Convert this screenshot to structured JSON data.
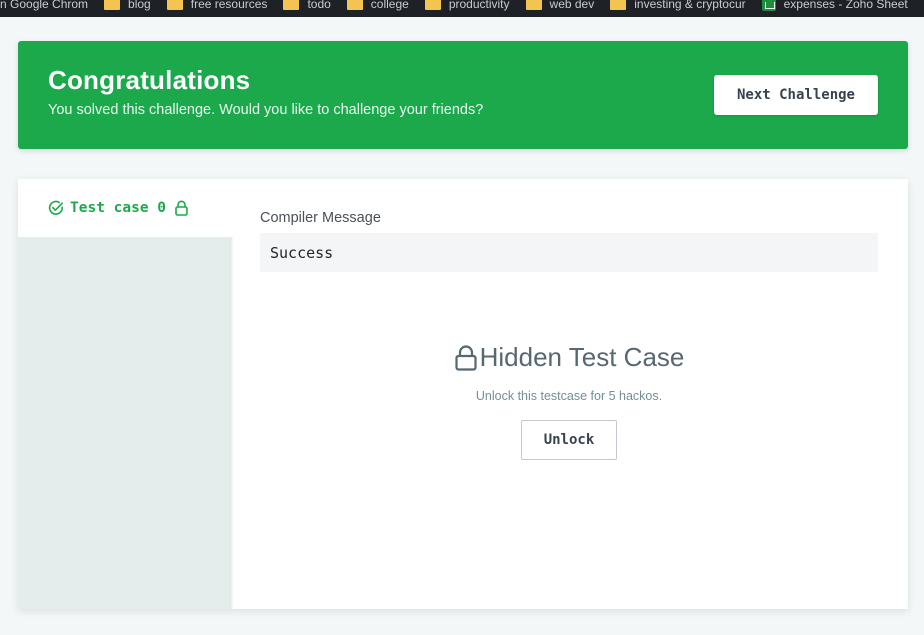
{
  "bookmarks": [
    {
      "label": "n Google Chrom",
      "icon": "none"
    },
    {
      "label": "blog",
      "icon": "folder-icon"
    },
    {
      "label": "free resources",
      "icon": "folder-icon"
    },
    {
      "label": "todo",
      "icon": "folder-icon"
    },
    {
      "label": "college",
      "icon": "folder-icon"
    },
    {
      "label": "productivity",
      "icon": "folder-icon"
    },
    {
      "label": "web dev",
      "icon": "folder-icon"
    },
    {
      "label": "investing & cryptocur",
      "icon": "folder-icon"
    },
    {
      "label": "expenses - Zoho Sheet",
      "icon": "spreadsheet-icon"
    }
  ],
  "banner": {
    "title": "Congratulations",
    "subtitle": "You solved this challenge. Would you like to challenge your friends?",
    "next_button": "Next Challenge",
    "color": "#1ba94c"
  },
  "testcases": {
    "tabs": [
      {
        "label": "Test case 0",
        "status": "passed",
        "locked": true
      }
    ]
  },
  "compiler": {
    "label": "Compiler Message",
    "message": "Success"
  },
  "hidden": {
    "title": "Hidden Test Case",
    "note": "Unlock this testcase for 5 hackos.",
    "button": "Unlock"
  }
}
